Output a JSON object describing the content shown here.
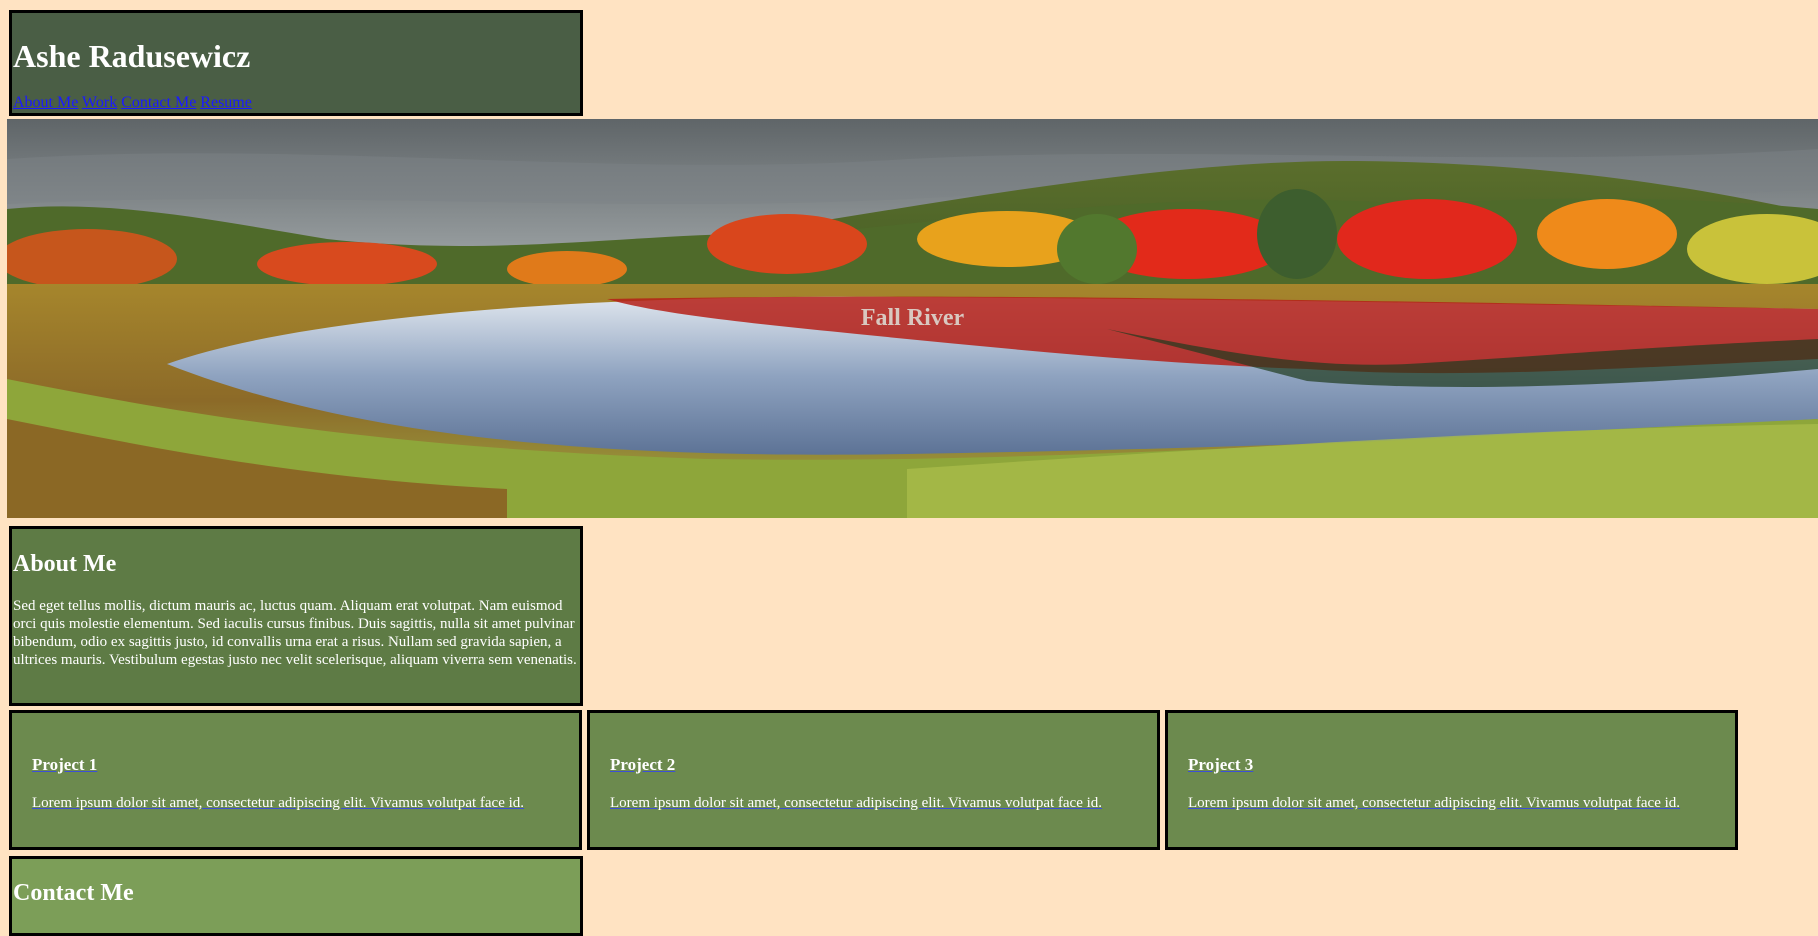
{
  "header": {
    "name": "Ashe Radusewicz",
    "nav": [
      "About Me",
      "Work",
      "Contact Me",
      "Resume"
    ]
  },
  "hero": {
    "title": "Fall River"
  },
  "about": {
    "heading": "About Me",
    "text": "Sed eget tellus mollis, dictum mauris ac, luctus quam. Aliquam erat volutpat. Nam euismod orci quis molestie elementum. Sed iaculis cursus finibus. Duis sagittis, nulla sit amet pulvinar bibendum, odio ex sagittis justo, id convallis urna erat a risus. Nullam sed gravida sapien, a ultrices mauris. Vestibulum egestas justo nec velit scelerisque, aliquam viverra sem venenatis."
  },
  "projects": [
    {
      "title": "Project 1",
      "text": "Lorem ipsum dolor sit amet, consectetur adipiscing elit. Vivamus volutpat face id."
    },
    {
      "title": "Project 2",
      "text": "Lorem ipsum dolor sit amet, consectetur adipiscing elit. Vivamus volutpat face id."
    },
    {
      "title": "Project 3",
      "text": "Lorem ipsum dolor sit amet, consectetur adipiscing elit. Vivamus volutpat face id."
    }
  ],
  "contact": {
    "heading": "Contact Me"
  },
  "colors": {
    "page_background": "#ffe3c2",
    "header_background": "#4a5e45",
    "about_background": "#5e7b45",
    "project_background": "#6c8a4e",
    "contact_background": "#7c9e58",
    "link": "#1a1aff"
  }
}
